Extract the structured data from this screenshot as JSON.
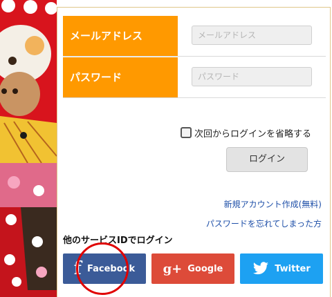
{
  "form": {
    "email_label": "メールアドレス",
    "email_placeholder": "メールアドレス",
    "email_value": "",
    "password_label": "パスワード",
    "password_placeholder": "パスワード",
    "password_value": ""
  },
  "remember": {
    "label": "次回からログインを省略する",
    "checked": false
  },
  "login_button": "ログイン",
  "links": {
    "register": "新規アカウント作成(無料)",
    "forgot_password": "パスワードを忘れてしまった方"
  },
  "other_services": {
    "heading": "他のサービスIDでログイン",
    "facebook": "Facebook",
    "google": "Google",
    "twitter": "Twitter"
  },
  "icons": {
    "facebook": "facebook-icon",
    "google": "google-plus-icon",
    "twitter": "twitter-bird-icon"
  },
  "colors": {
    "label_orange": "#ff9900",
    "facebook_blue": "#3b5b98",
    "google_red": "#dd4b39",
    "twitter_blue": "#1da1f2",
    "link_blue": "#1e4fa8",
    "highlight_red": "#e00000"
  }
}
